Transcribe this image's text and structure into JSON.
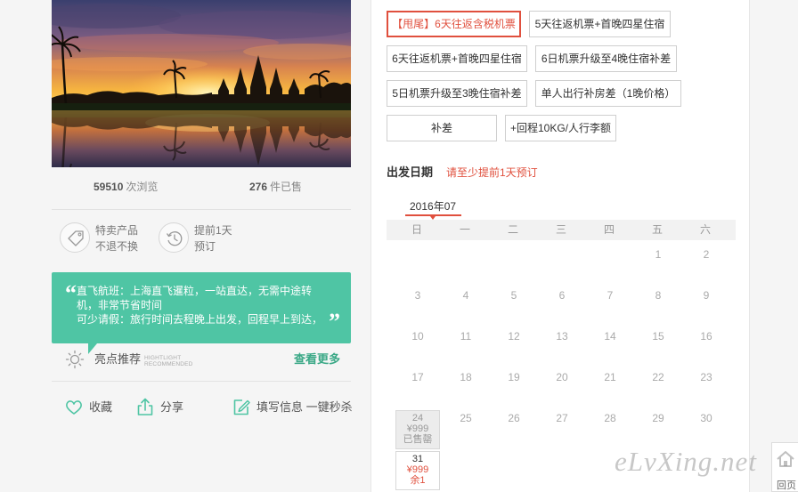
{
  "stats": {
    "views_value": "59510",
    "views_unit": "次浏览",
    "sold_value": "276",
    "sold_unit": "件已售"
  },
  "features": [
    {
      "icon": "tag-icon",
      "line1": "特卖产品",
      "line2": "不退不换"
    },
    {
      "icon": "clock-icon",
      "line1": "提前1天",
      "line2": "预订"
    }
  ],
  "highlight_quote": {
    "open": "“",
    "close": "”",
    "paragraphs": [
      "直飞航班：上海直飞暹粒，一站直达，无需中途转机，非常节省时间",
      "可少请假：旅行时间去程晚上出发，回程早上到达，"
    ]
  },
  "highlights_header": {
    "icon": "sun-icon",
    "title": "亮点推荐",
    "subtitle_line1": "HIGHTLIGHT",
    "subtitle_line2": "RECOMMENDED",
    "more_link": "查看更多"
  },
  "actions": {
    "favorite": "收藏",
    "share": "分享",
    "quick_buy": "填写信息 一键秒杀"
  },
  "package_options": [
    {
      "label": "【甩尾】6天往返含税机票",
      "selected": true
    },
    {
      "label": "5天往返机票+首晚四星住宿",
      "selected": false
    },
    {
      "label": "6天往返机票+首晚四星住宿",
      "selected": false
    },
    {
      "label": "6日机票升级至4晚住宿补差",
      "selected": false
    },
    {
      "label": "5日机票升级至3晚住宿补差",
      "selected": false
    },
    {
      "label": "单人出行补房差（1晚价格）",
      "selected": false
    },
    {
      "label": "补差",
      "selected": false
    },
    {
      "label": "+回程10KG/人行李额",
      "selected": false
    }
  ],
  "departure": {
    "label": "出发日期",
    "note": "请至少提前1天预订"
  },
  "calendar": {
    "month_label": "2016年07",
    "weekdays": [
      "日",
      "一",
      "二",
      "三",
      "四",
      "五",
      "六"
    ],
    "weeks": [
      [
        null,
        null,
        null,
        null,
        null,
        {
          "day": "1"
        },
        {
          "day": "2"
        }
      ],
      [
        {
          "day": "3"
        },
        {
          "day": "4"
        },
        {
          "day": "5"
        },
        {
          "day": "6"
        },
        {
          "day": "7"
        },
        {
          "day": "8"
        },
        {
          "day": "9"
        }
      ],
      [
        {
          "day": "10"
        },
        {
          "day": "11"
        },
        {
          "day": "12"
        },
        {
          "day": "13"
        },
        {
          "day": "14"
        },
        {
          "day": "15"
        },
        {
          "day": "16"
        }
      ],
      [
        {
          "day": "17"
        },
        {
          "day": "18"
        },
        {
          "day": "19"
        },
        {
          "day": "20"
        },
        {
          "day": "21"
        },
        {
          "day": "22"
        },
        {
          "day": "23"
        }
      ],
      [
        {
          "day": "24",
          "price": "¥999",
          "status": "已售罄",
          "sold_out": true
        },
        {
          "day": "25"
        },
        {
          "day": "26"
        },
        {
          "day": "27"
        },
        {
          "day": "28"
        },
        {
          "day": "29"
        },
        {
          "day": "30"
        }
      ],
      [
        {
          "day": "31",
          "price": "¥999",
          "status": "余1",
          "sold_out": false
        },
        null,
        null,
        null,
        null,
        null,
        null
      ]
    ]
  },
  "watermark": "eLvXing.net",
  "back_to_top": "回页",
  "colors": {
    "accent_green": "#4fc5a4",
    "link_green": "#3aa886",
    "alert_red": "#e0503e",
    "panel_bg": "#f5f5f5"
  }
}
